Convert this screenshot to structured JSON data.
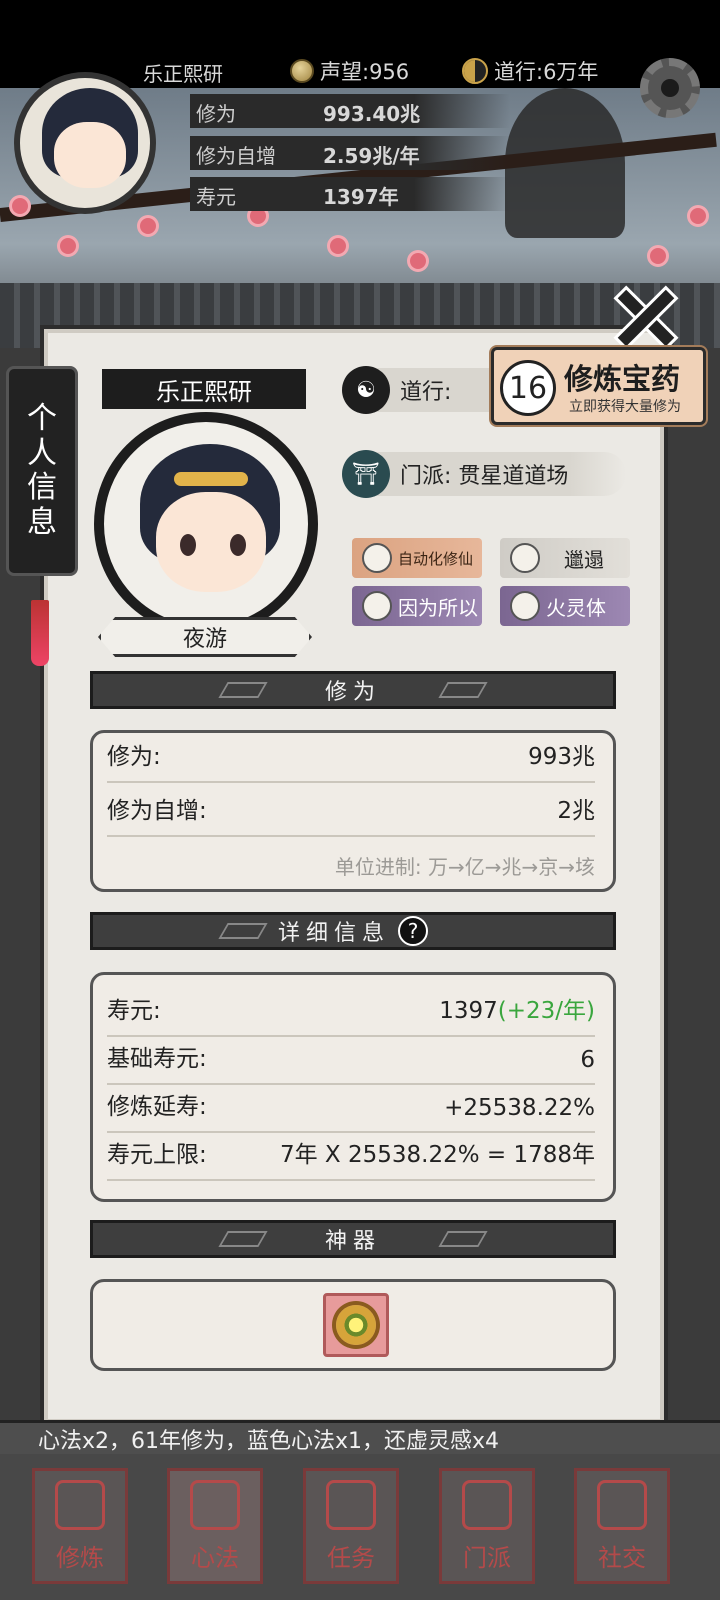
{
  "topbar": {
    "player_name": "乐正熙研",
    "fame": "声望:956",
    "dao": "道行:6万年"
  },
  "header_stats": [
    {
      "label": "修为",
      "value": "993.40兆"
    },
    {
      "label": "修为自增",
      "value": "2.59兆/年"
    },
    {
      "label": "寿元",
      "value": "1397年"
    }
  ],
  "side_tab": {
    "chars": [
      "个",
      "人",
      "信",
      "息"
    ]
  },
  "profile": {
    "name": "乐正熙研",
    "title": "夜游",
    "dao_label": "道行:",
    "sect": "门派: 贯星道道场"
  },
  "promo": {
    "count": "16",
    "title": "修炼宝药",
    "subtitle": "立即获得大量修为"
  },
  "tags": [
    {
      "label": "自动化修仙",
      "style": "orange"
    },
    {
      "label": "邋遢",
      "style": "gray"
    },
    {
      "label": "因为所以",
      "style": "purple"
    },
    {
      "label": "火灵体",
      "style": "purple"
    }
  ],
  "cultivation": {
    "header": "修为",
    "rows": [
      {
        "label": "修为:",
        "value": "993兆"
      },
      {
        "label": "修为自增:",
        "value": "2兆"
      }
    ],
    "hint": "单位进制: 万→亿→兆→京→垓"
  },
  "details": {
    "header": "详细信息",
    "help": "?",
    "rows": [
      {
        "label": "寿元:",
        "value": "1397",
        "extra": "(+23/年)"
      },
      {
        "label": "基础寿元:",
        "value": "6",
        "extra": ""
      },
      {
        "label": "修炼延寿:",
        "value": "+25538.22%",
        "extra": ""
      },
      {
        "label": "寿元上限:",
        "value": "7年 X 25538.22% = 1788年",
        "extra": ""
      }
    ]
  },
  "artifact": {
    "header": "神器"
  },
  "ticker": "心法x2，61年修为，蓝色心法x1，还虚灵感x4",
  "nav": [
    {
      "label": "修炼"
    },
    {
      "label": "心法"
    },
    {
      "label": "任务"
    },
    {
      "label": "门派"
    },
    {
      "label": "社交"
    }
  ],
  "colors": {
    "accent_green": "#3aa63e",
    "promo_bg": "#f0d2b8",
    "panel_bg": "#ebe9e4"
  }
}
